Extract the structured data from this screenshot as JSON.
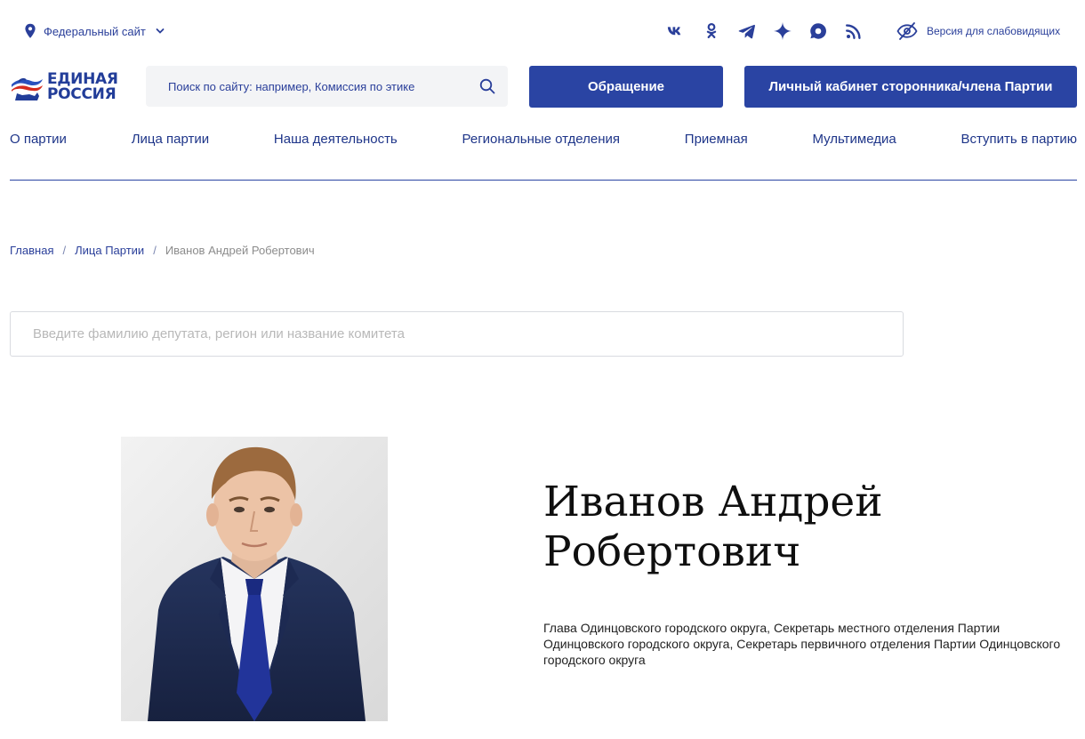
{
  "topbar": {
    "federal_label": "Федеральный сайт",
    "impaired_label": "Версия для слабовидящих",
    "socials": [
      "vk-icon",
      "odnoklassniki-icon",
      "telegram-icon",
      "dzen-icon",
      "max-messenger-icon",
      "rss-icon"
    ]
  },
  "header": {
    "logo_line1": "ЕДИНАЯ",
    "logo_line2": "РОССИЯ",
    "search_placeholder": "Поиск по сайту: например, Комиссия по этике",
    "appeal_button": "Обращение",
    "cabinet_button": "Личный кабинет сторонника/члена Партии"
  },
  "nav": {
    "items": [
      {
        "label": "О партии"
      },
      {
        "label": "Лица партии"
      },
      {
        "label": "Наша деятельность"
      },
      {
        "label": "Региональные отделения"
      },
      {
        "label": "Приемная"
      },
      {
        "label": "Мультимедиа"
      },
      {
        "label": "Вступить в партию"
      }
    ]
  },
  "breadcrumb": {
    "home": "Главная",
    "section": "Лица Партии",
    "separator": "/",
    "current": "Иванов Андрей Робертович"
  },
  "deputy_search": {
    "placeholder": "Введите фамилию депутата, регион или название комитета"
  },
  "profile": {
    "name": "Иванов Андрей Робертович",
    "roles": "Глава Одинцовского городского округа, Секретарь местного отделения Партии Одинцовского городского округа, Секретарь первичного отделения Партии Одинцовского городского округа"
  },
  "colors": {
    "brand_blue": "#2a44a3",
    "link_blue": "#2a3f9a",
    "nav_line": "#2a44a3"
  }
}
